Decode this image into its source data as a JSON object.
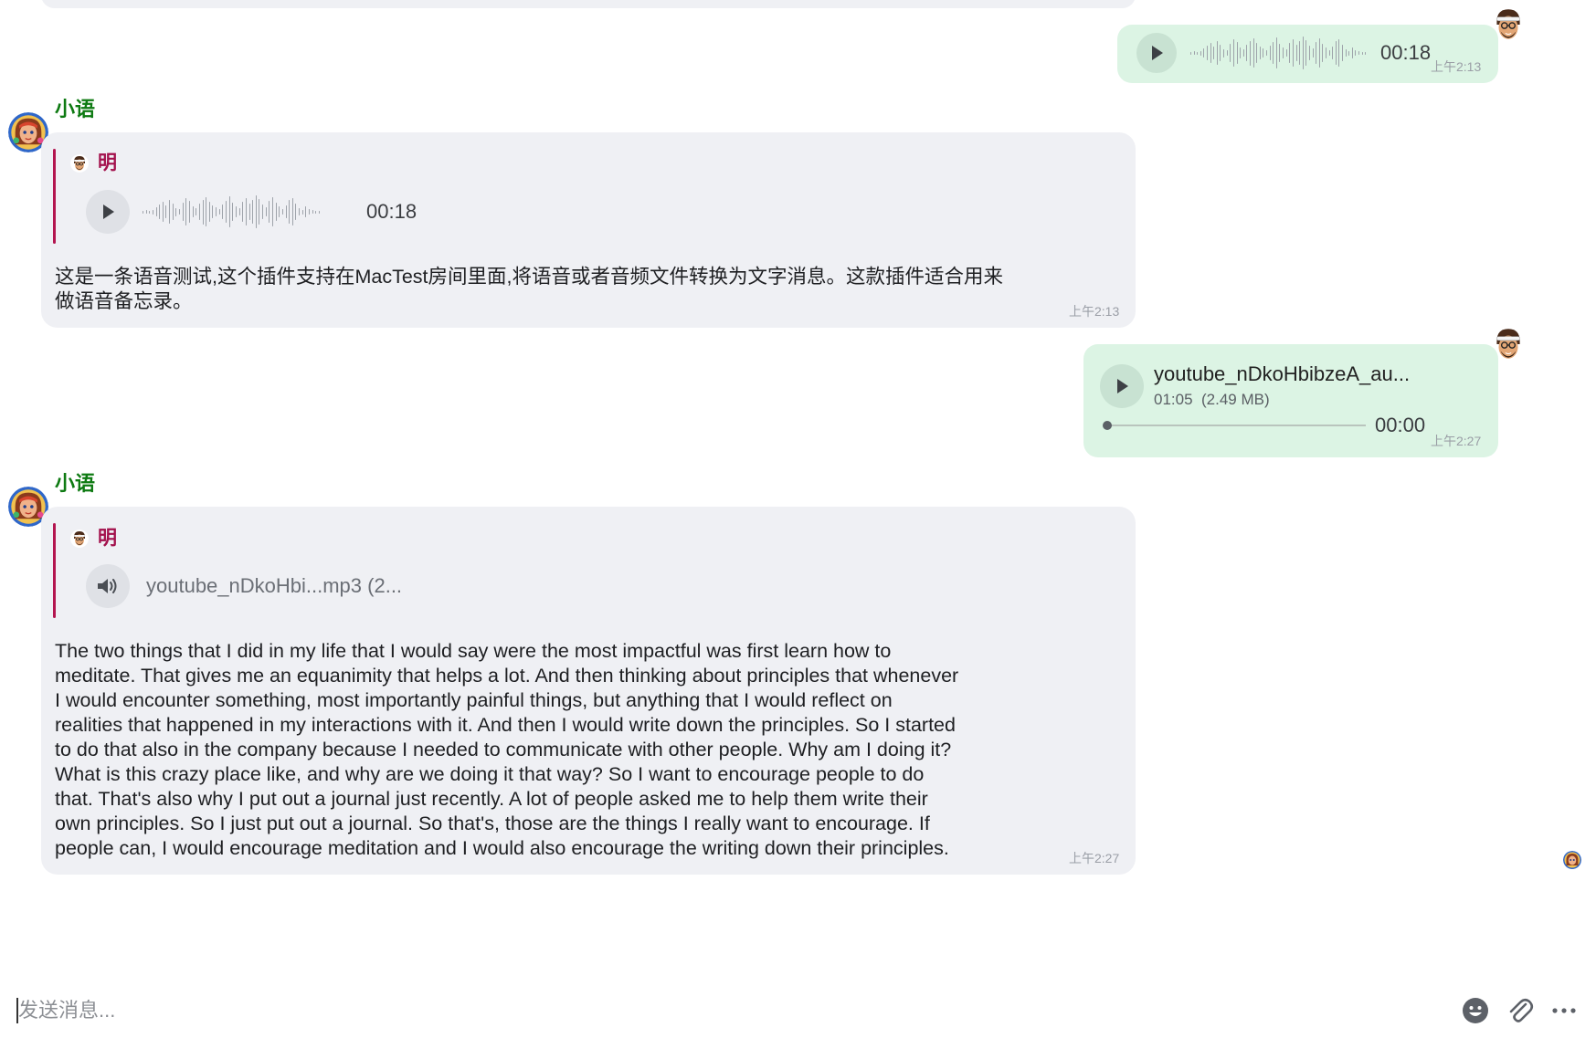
{
  "voice_message": {
    "duration": "00:18",
    "time": "上午2:13"
  },
  "reply_1": {
    "sender": "小语",
    "quote": {
      "sender": "明",
      "duration": "00:18"
    },
    "text": "这是一条语音测试,这个插件支持在MacTest房间里面,将语音或者音频文件转换为文字消息。这款插件适合用来\n做语音备忘录。",
    "time": "上午2:13"
  },
  "audio_message": {
    "filename": "youtube_nDkoHbibzeA_au...",
    "meta": "01:05  (2.49 MB)",
    "position": "00:00",
    "progress": 0,
    "time": "上午2:27"
  },
  "reply_2": {
    "sender": "小语",
    "quote": {
      "sender": "明",
      "file": "youtube_nDkoHbi...mp3 (2..."
    },
    "text": "The two things that I did in my life that I would say were the most impactful was first learn how to\nmeditate. That gives me an equanimity that helps a lot. And then thinking about principles that whenever\nI would encounter something, most importantly painful things, but anything that I would reflect on\nrealities that happened in my interactions with it. And then I would write down the principles. So I started\nto do that also in the company because I needed to communicate with other people. Why am I doing it?\nWhat is this crazy place like, and why are we doing it that way? So I want to encourage people to do\nthat. That's also why I put out a journal just recently. A lot of people asked me to help them write their\nown principles. So I just put out a journal. So that's, those are the things I really want to encourage. If\npeople can, I would encourage meditation and I would also encourage the writing down their principles.",
    "time": "上午2:27"
  },
  "composer": {
    "placeholder": "发送消息...",
    "icons": [
      "emoji-icon",
      "paperclip-icon",
      "more-icon"
    ]
  },
  "colors": {
    "sender_name": "#0e7a12",
    "quote_accent": "#b3154f",
    "incoming_bubble": "#eff0f4",
    "outgoing_bubble": "#dcf4e4"
  }
}
